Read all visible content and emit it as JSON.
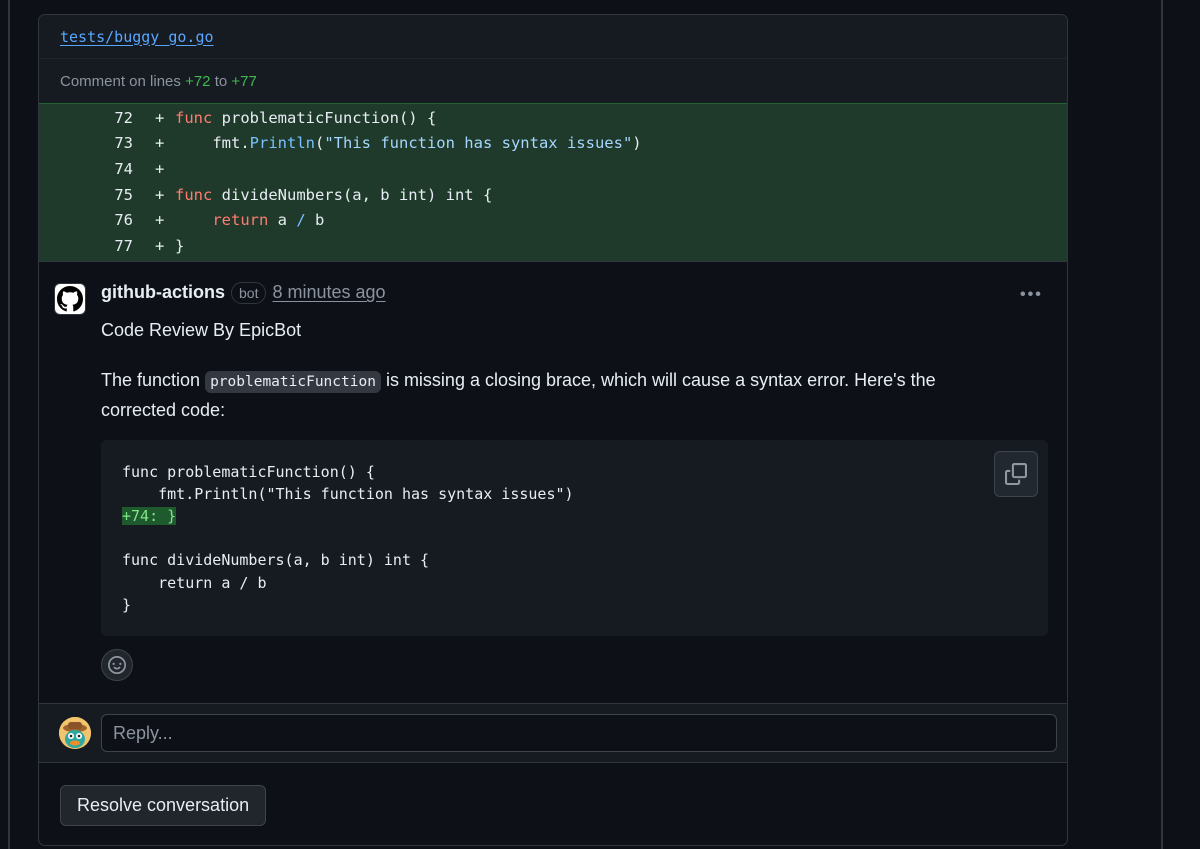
{
  "file": {
    "path": "tests/buggy_go.go"
  },
  "comment_range": {
    "prefix": "Comment on lines",
    "start": "+72",
    "connector": "to",
    "end": "+77"
  },
  "diff": [
    {
      "num": "72",
      "sign": "+",
      "parts": [
        {
          "t": "kw",
          "v": "func"
        },
        {
          "t": "plain",
          "v": " problematicFunction() {"
        }
      ]
    },
    {
      "num": "73",
      "sign": "+",
      "parts": [
        {
          "t": "plain",
          "v": "    fmt."
        },
        {
          "t": "call",
          "v": "Println"
        },
        {
          "t": "plain",
          "v": "("
        },
        {
          "t": "str",
          "v": "\"This function has syntax issues\""
        },
        {
          "t": "plain",
          "v": ")"
        }
      ]
    },
    {
      "num": "74",
      "sign": "+",
      "parts": []
    },
    {
      "num": "75",
      "sign": "+",
      "parts": [
        {
          "t": "kw",
          "v": "func"
        },
        {
          "t": "plain",
          "v": " divideNumbers(a, b int) int {"
        }
      ]
    },
    {
      "num": "76",
      "sign": "+",
      "parts": [
        {
          "t": "kw",
          "v": "    return"
        },
        {
          "t": "plain",
          "v": " a "
        },
        {
          "t": "op",
          "v": "/"
        },
        {
          "t": "plain",
          "v": " b"
        }
      ]
    },
    {
      "num": "77",
      "sign": "+",
      "parts": [
        {
          "t": "plain",
          "v": "}"
        }
      ]
    }
  ],
  "comment": {
    "author": "github-actions",
    "badge": "bot",
    "time": "8 minutes ago",
    "more_icon": "kebab-horizontal-icon",
    "title": "Code Review By EpicBot",
    "body_before": "The function ",
    "body_code": "problematicFunction",
    "body_after": " is missing a closing brace, which will cause a syntax error. Here's the corrected code:",
    "code_lines": [
      {
        "text": "func problematicFunction() {",
        "highlight": false
      },
      {
        "text": "    fmt.Println(\"This function has syntax issues\")",
        "highlight": false
      },
      {
        "text": "+74: }",
        "highlight": true
      },
      {
        "text": "",
        "highlight": false
      },
      {
        "text": "func divideNumbers(a, b int) int {",
        "highlight": false
      },
      {
        "text": "    return a / b",
        "highlight": false
      },
      {
        "text": "}",
        "highlight": false
      }
    ]
  },
  "reply": {
    "placeholder": "Reply..."
  },
  "resolve": {
    "label": "Resolve conversation"
  },
  "colors": {
    "added_bg": "#1f3a2a",
    "link": "#58a6ff",
    "keyword": "#ff7b72",
    "line_ref": "#3fb950"
  }
}
